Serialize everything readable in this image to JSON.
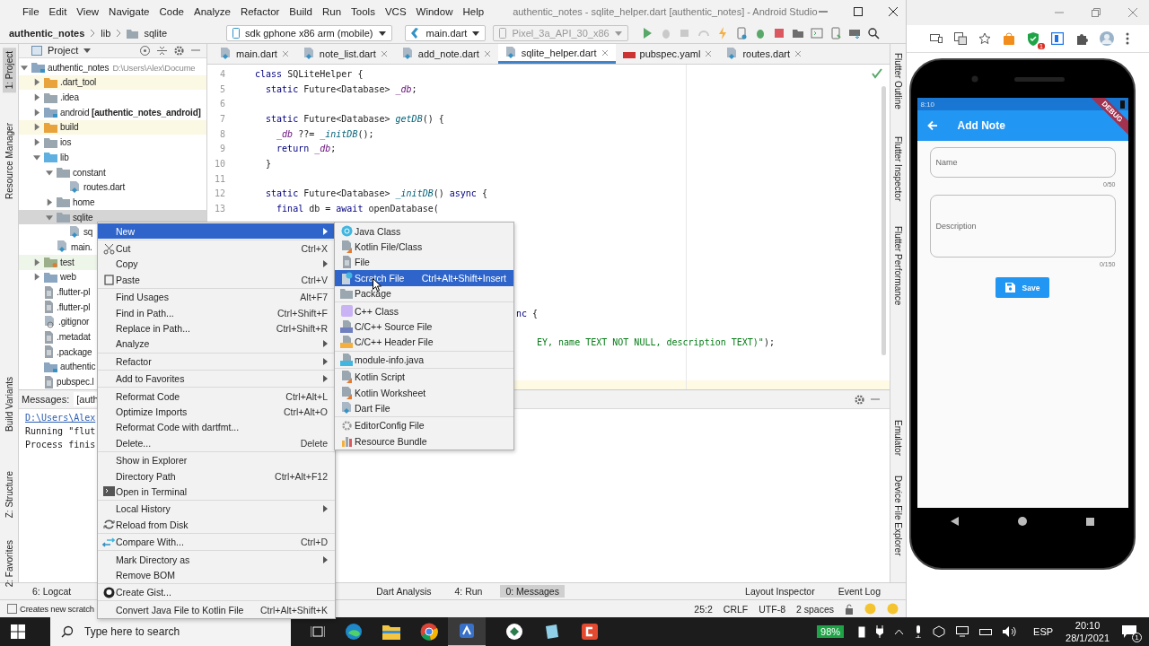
{
  "ide": {
    "menu": [
      "File",
      "Edit",
      "View",
      "Navigate",
      "Code",
      "Analyze",
      "Refactor",
      "Build",
      "Run",
      "Tools",
      "VCS",
      "Window",
      "Help"
    ],
    "title": "authentic_notes - sqlite_helper.dart [authentic_notes] - Android Studio",
    "breadcrumb": [
      "authentic_notes",
      "lib",
      "sqlite"
    ],
    "device_selector": "sdk gphone x86 arm (mobile)",
    "run_config": "main.dart",
    "emulator_selector": {
      "label": "Pixel_3a_API_30_x86",
      "disabled": true
    },
    "left_tool_tabs": [
      {
        "label": "1: Project",
        "selected": true
      },
      {
        "label": "Resource Manager",
        "selected": false
      },
      {
        "label": "Build Variants",
        "selected": false
      },
      {
        "label": "Z: Structure",
        "selected": false
      },
      {
        "label": "2: Favorites",
        "selected": false
      }
    ],
    "right_tool_tabs": [
      "Flutter Outline",
      "Flutter Inspector",
      "Flutter Performance",
      "Emulator",
      "Device File Explorer"
    ],
    "project": {
      "title": "Project",
      "tree": [
        {
          "label": "authentic_notes",
          "path": "D:\\Users\\Alex\\Docume",
          "kind": "module",
          "expanded": true,
          "selected": false,
          "children": [
            {
              "label": ".dart_tool",
              "kind": "excluded",
              "expanded": false,
              "selected": false
            },
            {
              "label": ".idea",
              "kind": "config",
              "expanded": false,
              "selected": false
            },
            {
              "label": "android **[authentic_notes_android]**",
              "kind": "module",
              "expanded": false,
              "selected": false
            },
            {
              "label": "build",
              "kind": "excluded",
              "expanded": false,
              "selected": false
            },
            {
              "label": "ios",
              "kind": "folder",
              "expanded": false,
              "selected": false
            },
            {
              "label": "lib",
              "kind": "source",
              "expanded": true,
              "selected": false,
              "children": [
                {
                  "label": "constant",
                  "kind": "folder",
                  "expanded": true,
                  "selected": false,
                  "children": [
                    {
                      "label": "routes.dart",
                      "kind": "dart",
                      "selected": false
                    }
                  ]
                },
                {
                  "label": "home",
                  "kind": "folder",
                  "expanded": false,
                  "selected": false
                },
                {
                  "label": "sqlite",
                  "kind": "folder",
                  "expanded": true,
                  "selected": true,
                  "children": [
                    {
                      "label": "sq",
                      "kind": "dart",
                      "selected": false
                    }
                  ]
                },
                {
                  "label": "main.",
                  "kind": "dart",
                  "selected": false
                }
              ]
            },
            {
              "label": "test",
              "kind": "test",
              "expanded": false,
              "selected": false
            },
            {
              "label": "web",
              "kind": "web",
              "expanded": false,
              "selected": false
            },
            {
              "label": ".flutter-pl",
              "kind": "text",
              "selected": false
            },
            {
              "label": ".flutter-pl",
              "kind": "text",
              "selected": false
            },
            {
              "label": ".gitignor",
              "kind": "ignore",
              "selected": false
            },
            {
              "label": ".metadat",
              "kind": "text",
              "selected": false
            },
            {
              "label": ".package",
              "kind": "text",
              "selected": false
            },
            {
              "label": "authentic",
              "kind": "iml",
              "selected": false
            },
            {
              "label": "pubspec.l",
              "kind": "text",
              "selected": false
            }
          ]
        }
      ]
    },
    "tabs": [
      {
        "label": "main.dart",
        "kind": "dart",
        "selected": false
      },
      {
        "label": "note_list.dart",
        "kind": "dart",
        "selected": false
      },
      {
        "label": "add_note.dart",
        "kind": "dart",
        "selected": false
      },
      {
        "label": "sqlite_helper.dart",
        "kind": "dart",
        "selected": true
      },
      {
        "label": "pubspec.yaml",
        "kind": "yaml",
        "selected": false
      },
      {
        "label": "routes.dart",
        "kind": "dart",
        "selected": false
      }
    ],
    "code": {
      "lines": [
        {
          "number": "4",
          "parts": [
            {
              "kind": "kw",
              "text": "class"
            },
            {
              "kind": "plain",
              "text": " SQLiteHelper {"
            }
          ]
        },
        {
          "number": "5",
          "parts": [
            {
              "kind": "kw",
              "text": "  static"
            },
            {
              "kind": "plain",
              "text": " Future<Database> "
            },
            {
              "kind": "field",
              "text": "_db"
            },
            {
              "kind": "plain",
              "text": ";"
            }
          ]
        },
        {
          "number": "6"
        },
        {
          "number": "7",
          "parts": [
            {
              "kind": "kw",
              "text": "  static"
            },
            {
              "kind": "plain",
              "text": " Future<Database> "
            },
            {
              "kind": "fn",
              "text": "getDB"
            },
            {
              "kind": "plain",
              "text": "() {"
            }
          ]
        },
        {
          "number": "8",
          "parts": [
            {
              "kind": "field",
              "text": "    _db"
            },
            {
              "kind": "plain",
              "text": " ??= "
            },
            {
              "kind": "fn",
              "text": "_initDB"
            },
            {
              "kind": "plain",
              "text": "();"
            }
          ]
        },
        {
          "number": "9",
          "parts": [
            {
              "kind": "kw",
              "text": "    return"
            },
            {
              "kind": "field",
              "text": " _db"
            },
            {
              "kind": "plain",
              "text": ";"
            }
          ]
        },
        {
          "number": "10",
          "parts": [
            {
              "kind": "plain",
              "text": "  }"
            }
          ]
        },
        {
          "number": "11"
        },
        {
          "number": "12",
          "parts": [
            {
              "kind": "kw",
              "text": "  static"
            },
            {
              "kind": "plain",
              "text": " Future<Database> "
            },
            {
              "kind": "fn",
              "text": "_initDB"
            },
            {
              "kind": "plain",
              "text": "() "
            },
            {
              "kind": "kw",
              "text": "async"
            },
            {
              "kind": "plain",
              "text": " {"
            }
          ]
        },
        {
          "number": "13",
          "parts": [
            {
              "kind": "kw",
              "text": "    final"
            },
            {
              "kind": "plain",
              "text": " db = "
            },
            {
              "kind": "kw",
              "text": "await"
            },
            {
              "kind": "plain",
              "text": " openDatabase("
            }
          ]
        }
      ],
      "tails": [
        {
          "parts": [
            {
              "kind": "kw",
              "text": "nc"
            },
            {
              "kind": "plain",
              "text": " {"
            }
          ]
        },
        {
          "parts": [
            {
              "kind": "str",
              "text": "EY, name TEXT NOT NULL, description TEXT)\""
            },
            {
              "kind": "plain",
              "text": ");"
            }
          ]
        }
      ]
    },
    "messages": {
      "title": "Messages:",
      "tab": "[auth",
      "lines": [
        {
          "kind": "link",
          "text": "D:\\Users\\Alex"
        },
        {
          "kind": "plain",
          "text": "Running \"flut"
        },
        {
          "kind": "plain",
          "text": "Process finis"
        }
      ]
    },
    "tool_bar": {
      "left": [
        {
          "label": "6: Logcat",
          "selected": false
        }
      ],
      "middle": [
        {
          "label": "Dart Analysis",
          "selected": false
        },
        {
          "label": "4: Run",
          "selected": false
        },
        {
          "label": "0: Messages",
          "selected": true
        }
      ],
      "right": [
        "Layout Inspector",
        "Event Log"
      ]
    },
    "status_bar": {
      "message": "Creates new scratch",
      "position": "25:2",
      "line_ending": "CRLF",
      "encoding": "UTF-8",
      "indent": "2 spaces"
    },
    "context_menu": {
      "groups": [
        [
          {
            "label": "New",
            "submenu": true,
            "selected": true
          }
        ],
        [
          {
            "label": "Cut",
            "shortcut": "Ctrl+X",
            "submenu": false,
            "selected": false
          },
          {
            "label": "Copy",
            "submenu": true,
            "selected": false
          },
          {
            "label": "Paste",
            "shortcut": "Ctrl+V",
            "submenu": false,
            "selected": false
          }
        ],
        [
          {
            "label": "Find Usages",
            "shortcut": "Alt+F7",
            "submenu": false,
            "selected": false
          },
          {
            "label": "Find in Path...",
            "shortcut": "Ctrl+Shift+F",
            "submenu": false,
            "selected": false
          },
          {
            "label": "Replace in Path...",
            "shortcut": "Ctrl+Shift+R",
            "submenu": false,
            "selected": false
          },
          {
            "label": "Analyze",
            "submenu": true,
            "selected": false
          }
        ],
        [
          {
            "label": "Refactor",
            "submenu": true,
            "selected": false
          }
        ],
        [
          {
            "label": "Add to Favorites",
            "submenu": true,
            "selected": false
          }
        ],
        [
          {
            "label": "Reformat Code",
            "shortcut": "Ctrl+Alt+L",
            "submenu": false,
            "selected": false
          },
          {
            "label": "Optimize Imports",
            "shortcut": "Ctrl+Alt+O",
            "submenu": false,
            "selected": false
          },
          {
            "label": "Reformat Code with dartfmt...",
            "submenu": false,
            "selected": false
          },
          {
            "label": "Delete...",
            "shortcut": "Delete",
            "submenu": false,
            "selected": false
          }
        ],
        [
          {
            "label": "Show in Explorer",
            "submenu": false,
            "selected": false
          },
          {
            "label": "Directory Path",
            "shortcut": "Ctrl+Alt+F12",
            "submenu": false,
            "selected": false
          },
          {
            "label": "Open in Terminal",
            "submenu": false,
            "selected": false
          }
        ],
        [
          {
            "label": "Local History",
            "submenu": true,
            "selected": false
          },
          {
            "label": "Reload from Disk",
            "submenu": false,
            "selected": false
          }
        ],
        [
          {
            "label": "Compare With...",
            "shortcut": "Ctrl+D",
            "submenu": false,
            "selected": false
          }
        ],
        [
          {
            "label": "Mark Directory as",
            "submenu": true,
            "selected": false
          },
          {
            "label": "Remove BOM",
            "submenu": false,
            "selected": false
          }
        ],
        [
          {
            "label": "Create Gist...",
            "submenu": false,
            "selected": false
          }
        ],
        [
          {
            "label": "Convert Java File to Kotlin File",
            "shortcut": "Ctrl+Alt+Shift+K",
            "submenu": false,
            "selected": false
          }
        ]
      ]
    },
    "new_submenu": {
      "groups": [
        [
          {
            "label": "Java Class",
            "selected": false
          },
          {
            "label": "Kotlin File/Class",
            "selected": false
          },
          {
            "label": "File",
            "selected": false
          },
          {
            "label": "Scratch File",
            "shortcut": "Ctrl+Alt+Shift+Insert",
            "selected": true
          },
          {
            "label": "Package",
            "selected": false
          }
        ],
        [
          {
            "label": "C++ Class",
            "selected": false
          },
          {
            "label": "C/C++ Source File",
            "selected": false
          },
          {
            "label": "C/C++ Header File",
            "selected": false
          }
        ],
        [
          {
            "label": "module-info.java",
            "selected": false
          }
        ],
        [
          {
            "label": "Kotlin Script",
            "selected": false
          },
          {
            "label": "Kotlin Worksheet",
            "selected": false
          },
          {
            "label": "Dart File",
            "selected": false
          }
        ],
        [
          {
            "label": "EditorConfig File",
            "selected": false
          },
          {
            "label": "Resource Bundle",
            "selected": false
          }
        ]
      ]
    }
  },
  "browser": {
    "extension_badge": "1"
  },
  "phone": {
    "status_time": "8:10",
    "banner": "DEBUG",
    "app_bar_title": "Add Note",
    "fields": [
      {
        "placeholder": "Name",
        "counter": "0/50",
        "kind": "single"
      },
      {
        "placeholder": "Description",
        "counter": "0/150",
        "kind": "multi"
      }
    ],
    "save_button": "Save"
  },
  "taskbar": {
    "search_placeholder": "Type here to search",
    "battery": "98%",
    "language": "ESP",
    "time": "20:10",
    "date": "28/1/2021",
    "notifications": "1"
  }
}
